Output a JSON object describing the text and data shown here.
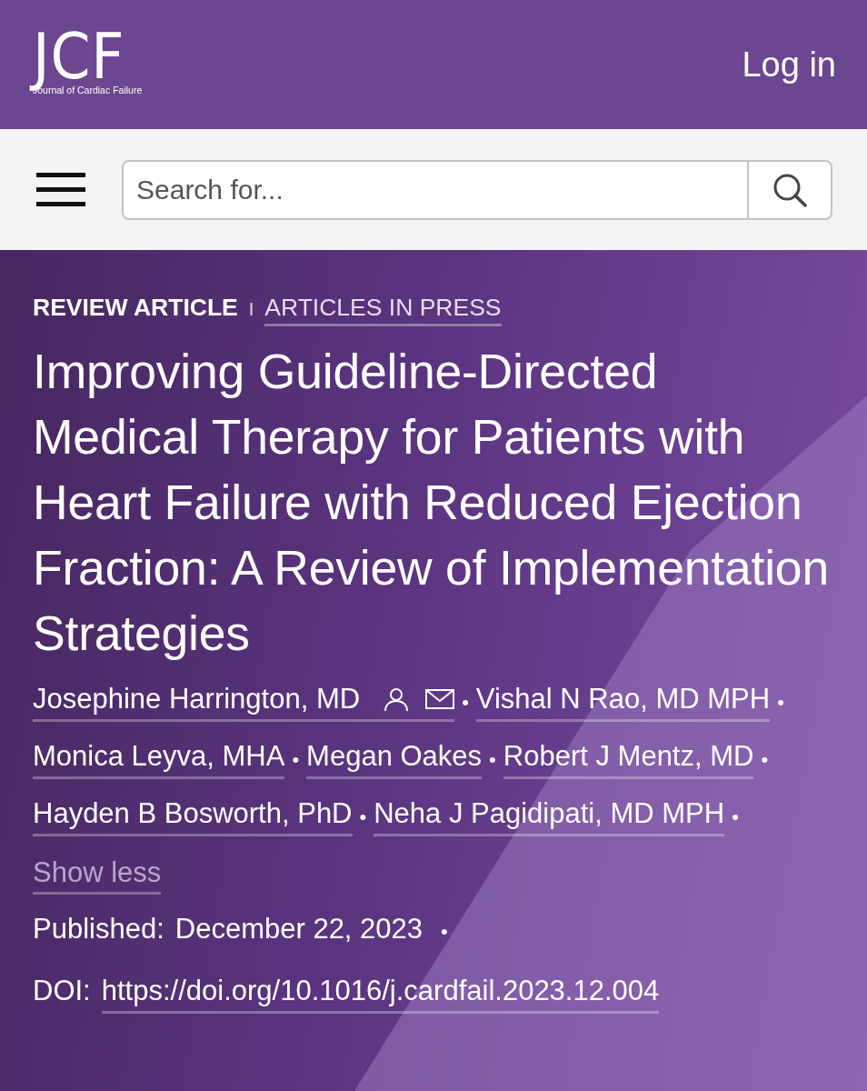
{
  "header": {
    "logo": {
      "letters": "JCF",
      "subtitle": "Journal of Cardiac Failure"
    },
    "login": "Log in"
  },
  "search": {
    "placeholder": "Search for..."
  },
  "article": {
    "type": "REVIEW ARTICLE",
    "divider": "I",
    "status": "ARTICLES IN PRESS",
    "title": "Improving Guideline-Directed Medical Therapy for Patients with Heart Failure with Reduced Ejection Fraction: A Review of Implementation Strategies",
    "authors": [
      {
        "name": "Josephine Harrington, MD",
        "kind": "corresponding",
        "separator": "•"
      },
      {
        "name": "Vishal N Rao, MD MPH",
        "kind": "plain",
        "separator": "•"
      },
      {
        "name": "Monica Leyva, MHA",
        "kind": "plain",
        "separator": "•"
      },
      {
        "name": "Megan Oakes",
        "kind": "plain",
        "separator": "•"
      },
      {
        "name": "Robert J Mentz, MD",
        "kind": "plain",
        "separator": "•"
      },
      {
        "name": "Hayden B Bosworth, PhD",
        "kind": "plain",
        "separator": "•"
      },
      {
        "name": "Neha J Pagidipati, MD MPH",
        "kind": "plain",
        "separator": "•"
      }
    ],
    "toggle": "Show less",
    "published": {
      "label": "Published:",
      "date": "December 22, 2023",
      "separator": "•"
    },
    "doi": {
      "label": "DOI:",
      "link": "https://doi.org/10.1016/j.cardfail.2023.12.004"
    }
  }
}
